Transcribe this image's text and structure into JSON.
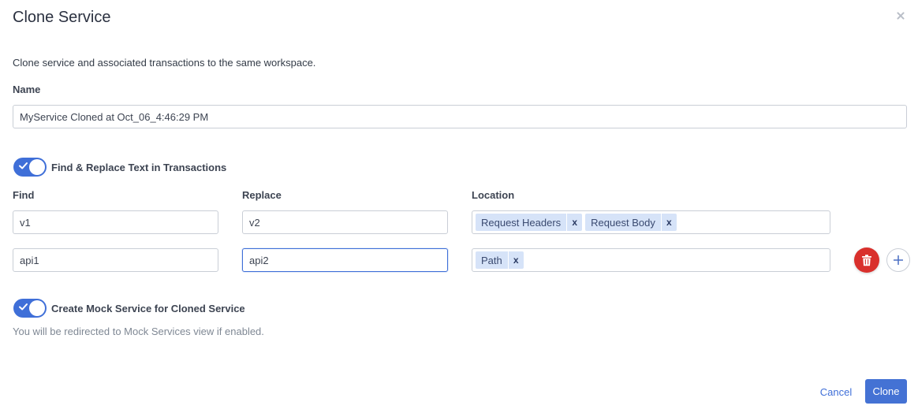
{
  "dialog": {
    "title": "Clone Service",
    "description": "Clone service and associated transactions to the same workspace."
  },
  "name_field": {
    "label": "Name",
    "value": "MyService Cloned at Oct_06_4:46:29 PM"
  },
  "find_replace": {
    "enabled": true,
    "toggle_label": "Find & Replace Text in Transactions",
    "columns": {
      "find": "Find",
      "replace": "Replace",
      "location": "Location"
    },
    "rows": [
      {
        "find": "v1",
        "replace": "v2",
        "locations": [
          "Request Headers",
          "Request Body"
        ]
      },
      {
        "find": "api1",
        "replace": "api2",
        "locations": [
          "Path"
        ]
      }
    ],
    "tag_remove_glyph": "x"
  },
  "mock_service": {
    "enabled": true,
    "toggle_label": "Create Mock Service for Cloned Service",
    "hint": "You will be redirected to Mock Services view if enabled."
  },
  "footer": {
    "cancel_label": "Cancel",
    "clone_label": "Clone"
  },
  "icons": {
    "close": "close-icon",
    "delete": "trash-icon",
    "add": "plus-icon",
    "check": "check-icon"
  },
  "colors": {
    "accent": "#3f6fd8",
    "danger": "#d9302c",
    "tag_bg": "#d6e3f8"
  }
}
